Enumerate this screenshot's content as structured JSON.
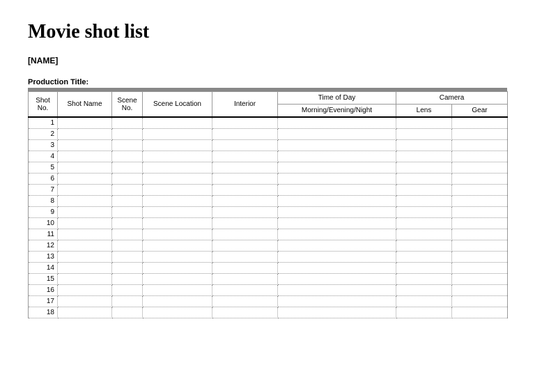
{
  "title": "Movie shot list",
  "name_placeholder": "[NAME]",
  "production_title_label": "Production Title:",
  "columns": {
    "shot_no": "Shot No.",
    "shot_name": "Shot Name",
    "scene_no": "Scene No.",
    "scene_location": "Scene Location",
    "interior": "Interior",
    "time_of_day": "Time of Day",
    "time_of_day_sub": "Morning/Evening/Night",
    "camera": "Camera",
    "lens": "Lens",
    "gear": "Gear"
  },
  "rows": [
    {
      "no": "1"
    },
    {
      "no": "2"
    },
    {
      "no": "3"
    },
    {
      "no": "4"
    },
    {
      "no": "5"
    },
    {
      "no": "6"
    },
    {
      "no": "7"
    },
    {
      "no": "8"
    },
    {
      "no": "9"
    },
    {
      "no": "10"
    },
    {
      "no": "11"
    },
    {
      "no": "12"
    },
    {
      "no": "13"
    },
    {
      "no": "14"
    },
    {
      "no": "15"
    },
    {
      "no": "16"
    },
    {
      "no": "17"
    },
    {
      "no": "18"
    }
  ]
}
